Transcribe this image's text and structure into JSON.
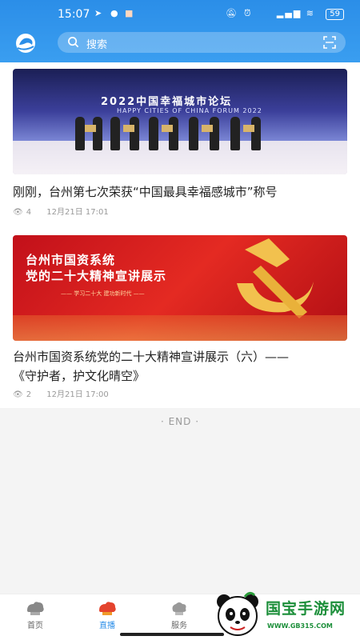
{
  "status_bar": {
    "time": "15:07",
    "battery": "59"
  },
  "search": {
    "placeholder": "搜索"
  },
  "articles": [
    {
      "title": "刚刚，台州第七次荣获“中国最具幸福感城市”称号",
      "views": "4",
      "date": "12月21日 17:01",
      "image_text_1": "2022中国幸福城市论坛",
      "image_text_2": "HAPPY CITIES OF CHINA FORUM 2022"
    },
    {
      "title_line1": "台州市国资系统党的二十大精神宣讲展示（六）——",
      "title_line2": "《守护者，护文化晴空》",
      "views": "2",
      "date": "12月21日 17:00",
      "image_text_1": "台州市国资系统",
      "image_text_2": "党的二十大精神宣讲展示",
      "image_text_3": "—— 学习二十大  建功新时代 ——"
    }
  ],
  "end_text": "· END ·",
  "tabs": [
    {
      "label": "首页",
      "icon": "home-icon"
    },
    {
      "label": "直播",
      "icon": "live-icon"
    },
    {
      "label": "服务",
      "icon": "service-icon"
    }
  ],
  "watermark": {
    "text": "国宝手游网",
    "url": "WWW.GB315.COM"
  },
  "colors": {
    "accent": "#2b8ee8",
    "header": "#3a9ef0",
    "party_red": "#d41c1c"
  }
}
